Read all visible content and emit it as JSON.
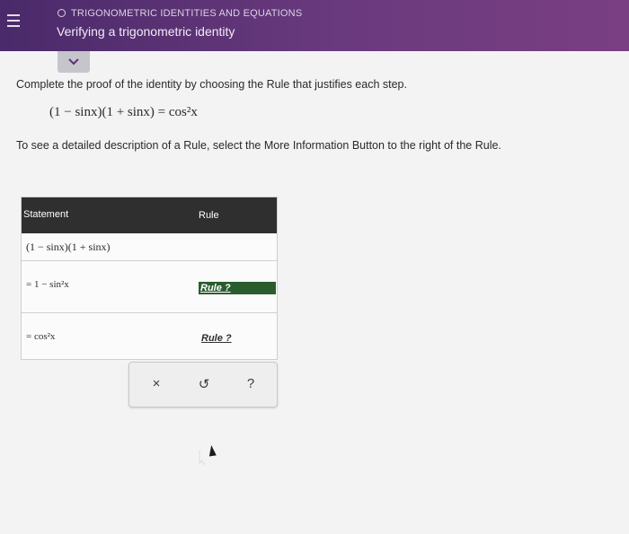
{
  "header": {
    "topic": "TRIGONOMETRIC IDENTITIES AND EQUATIONS",
    "subtitle": "Verifying a trigonometric identity"
  },
  "content": {
    "instruction": "Complete the proof of the identity by choosing the Rule that justifies each step.",
    "identity": "(1 − sinx)(1 + sinx) = cos²x",
    "more_info_text": "To see a detailed description of a Rule, select the More Information Button to the right of the Rule."
  },
  "table": {
    "headers": {
      "statement": "Statement",
      "rule": "Rule"
    },
    "rows": [
      {
        "statement": "(1  −  sinx)(1  +  sinx)",
        "rule": ""
      },
      {
        "statement": "= 1  −  sin²x",
        "rule": "Rule ?"
      },
      {
        "statement": "=  cos²x",
        "rule": "Rule ?"
      }
    ]
  },
  "actions": {
    "clear": "×",
    "undo": "↺",
    "help": "?"
  },
  "colors": {
    "header_bg": "#5a3372",
    "table_header_bg": "#2f2f2f",
    "rule_selected_bg": "#2a5d2e"
  }
}
